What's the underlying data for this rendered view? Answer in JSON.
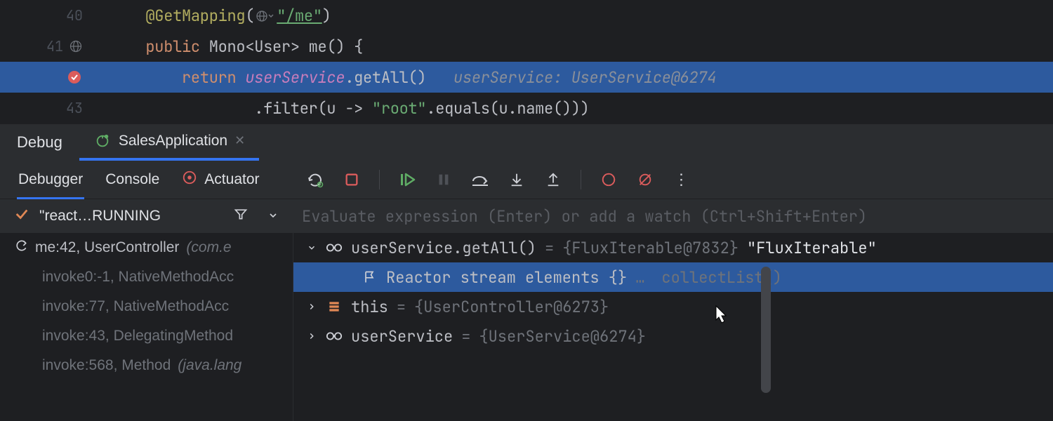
{
  "editor": {
    "lines": [
      {
        "num": "40",
        "icon": null,
        "highlighted": false,
        "segments": [
          {
            "cls": "tok-plain",
            "t": "      "
          },
          {
            "cls": "tok-ann",
            "t": "@GetMapping"
          },
          {
            "cls": "tok-plain",
            "t": "("
          },
          {
            "cls": "globe",
            "t": ""
          },
          {
            "cls": "tok-str-u",
            "t": "\"/me\""
          },
          {
            "cls": "tok-plain",
            "t": ")"
          }
        ]
      },
      {
        "num": "41",
        "icon": "globe",
        "highlighted": false,
        "segments": [
          {
            "cls": "tok-plain",
            "t": "      "
          },
          {
            "cls": "tok-kw",
            "t": "public"
          },
          {
            "cls": "tok-plain",
            "t": " Mono<User> "
          },
          {
            "cls": "tok-fn",
            "t": "me"
          },
          {
            "cls": "tok-plain",
            "t": "() {"
          }
        ]
      },
      {
        "num": "",
        "icon": "breakpoint",
        "highlighted": true,
        "segments": [
          {
            "cls": "tok-plain",
            "t": "          "
          },
          {
            "cls": "tok-kw",
            "t": "return"
          },
          {
            "cls": "tok-plain",
            "t": " "
          },
          {
            "cls": "tok-field",
            "t": "userService"
          },
          {
            "cls": "tok-plain",
            "t": ".getAll()   "
          },
          {
            "cls": "tok-hint",
            "t": "userService: UserService@6274"
          }
        ]
      },
      {
        "num": "43",
        "icon": null,
        "highlighted": false,
        "segments": [
          {
            "cls": "tok-plain",
            "t": "                  .filter("
          },
          {
            "cls": "tok-plain",
            "t": "u"
          },
          {
            "cls": "tok-plain",
            "t": " -> "
          },
          {
            "cls": "tok-str",
            "t": "\"root\""
          },
          {
            "cls": "tok-plain",
            "t": ".equals(u.name()))"
          }
        ]
      }
    ]
  },
  "debugHeader": {
    "title": "Debug",
    "runConfig": "SalesApplication"
  },
  "subTabs": {
    "debugger": "Debugger",
    "console": "Console",
    "actuator": "Actuator"
  },
  "thread": {
    "label": "\"react…RUNNING"
  },
  "frames": [
    {
      "icon": true,
      "label": "me:42, UserController ",
      "pkg": "(com.e"
    },
    {
      "icon": false,
      "label": "invoke0:-1, NativeMethodAcc",
      "pkg": ""
    },
    {
      "icon": false,
      "label": "invoke:77, NativeMethodAcc",
      "pkg": ""
    },
    {
      "icon": false,
      "label": "invoke:43, DelegatingMethod",
      "pkg": ""
    },
    {
      "icon": false,
      "label": "invoke:568, Method ",
      "pkg": "(java.lang"
    }
  ],
  "eval": {
    "placeholder": "Evaluate expression (Enter) or add a watch (Ctrl+Shift+Enter)"
  },
  "vars": [
    {
      "expanded": true,
      "icon": "glasses",
      "selected": false,
      "name": "userService.getAll()",
      "eq": " = ",
      "value": "{FluxIterable@7832} ",
      "tail": "\"FluxIterable\"",
      "indent": 0
    },
    {
      "expanded": null,
      "icon": "flag",
      "selected": true,
      "name": "Reactor stream elements {}",
      "eq": "  … ",
      "value": "",
      "tail": "collectList()",
      "indent": 1
    },
    {
      "expanded": false,
      "icon": "stack",
      "selected": false,
      "name": "this",
      "eq": " = ",
      "value": "{UserController@6273}",
      "tail": "",
      "indent": 0
    },
    {
      "expanded": false,
      "icon": "glasses",
      "selected": false,
      "name": "userService",
      "eq": " = ",
      "value": "{UserService@6274}",
      "tail": "",
      "indent": 0
    }
  ]
}
